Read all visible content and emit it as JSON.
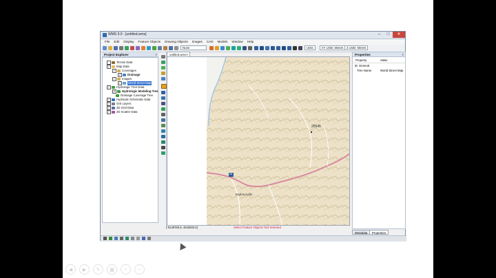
{
  "window": {
    "title": "WMS 9.0 - [untitled.wms]",
    "controls": [
      "–",
      "□",
      "✕"
    ]
  },
  "menu": [
    "File",
    "Edit",
    "Display",
    "Feature Objects",
    "Drawing Objects",
    "Images",
    "CAD",
    "Models",
    "Window",
    "Help"
  ],
  "toolbar": {
    "model_select": "None",
    "hunit_label": "Units",
    "hunit": "XY Units: Meters",
    "vunit": "Z Units: Meters"
  },
  "explorer": {
    "title": "Project Explorer",
    "nodes": [
      {
        "label": "Terrain Data"
      },
      {
        "label": "Map Data"
      },
      {
        "label": "Coverages"
      },
      {
        "label": "Drainage"
      },
      {
        "label": "Images"
      },
      {
        "label": "World Street Map"
      },
      {
        "label": "Hydrologic Tree Data"
      },
      {
        "label": "Hydrologic Modeling Tree"
      },
      {
        "label": "Drainage Coverage Tree"
      },
      {
        "label": "Hydraulic Schematic Data"
      },
      {
        "label": "GIS Layers"
      },
      {
        "label": "2D Grid Data"
      },
      {
        "label": "2D Scatter Data"
      }
    ]
  },
  "document": {
    "tab": "untitled.wms"
  },
  "map": {
    "label_number": "25545",
    "label_town": "Barbourville",
    "route_shield": "25"
  },
  "status": {
    "coords": "(-9149765.8, 4643833.0)",
    "message": "Select Feature Objects Tool Selected"
  },
  "properties": {
    "title": "Properties",
    "col_property": "Property",
    "col_value": "Value",
    "group": "General",
    "rows": [
      {
        "name": "Tree Name",
        "value": "World Street Map"
      }
    ],
    "tabs": [
      "Metadata",
      "Properties"
    ]
  },
  "colors": {
    "accent": "#3874d0",
    "status_message": "#c51c3c",
    "map_bg": "#ede2c8",
    "road": "#d88aa0",
    "river": "#9ec2e6"
  }
}
